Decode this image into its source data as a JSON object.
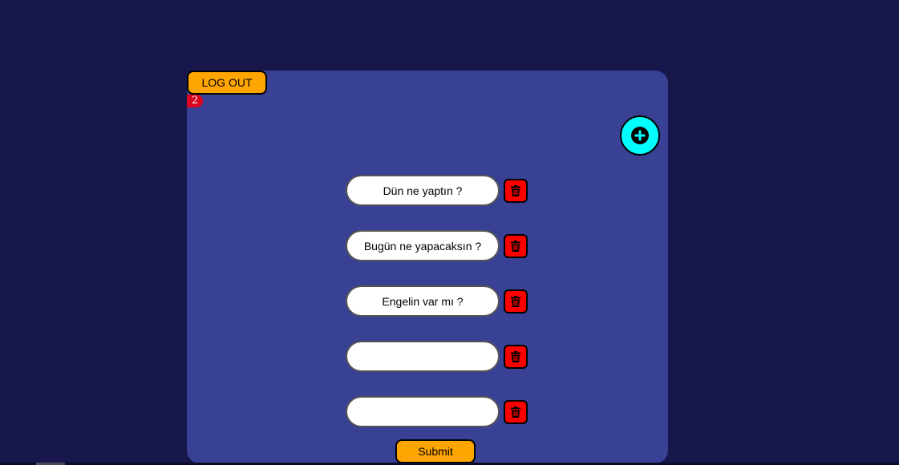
{
  "colors": {
    "page_background": "#17174c",
    "panel_background": "#384194",
    "accent_orange": "#ffa500",
    "add_button": "#00ffff",
    "delete_button": "#ff0000",
    "badge": "#d9041b"
  },
  "header": {
    "logout_label": "LOG OUT",
    "badge_count": "2"
  },
  "add_button": {
    "icon": "plus-circle-icon"
  },
  "questions": [
    {
      "value": "Dün ne yaptın ?",
      "delete_icon": "trash-icon"
    },
    {
      "value": "Bugün ne yapacaksın ?",
      "delete_icon": "trash-icon"
    },
    {
      "value": "Engelin var mı ?",
      "delete_icon": "trash-icon"
    },
    {
      "value": "",
      "delete_icon": "trash-icon"
    },
    {
      "value": "",
      "delete_icon": "trash-icon"
    }
  ],
  "submit_label": "Submit"
}
